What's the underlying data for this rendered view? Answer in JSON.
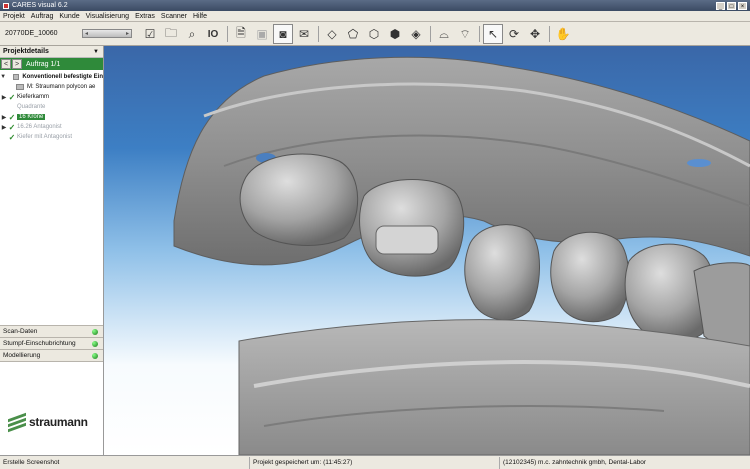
{
  "window": {
    "title": "CARES visual 6.2"
  },
  "menu": [
    "Projekt",
    "Auftrag",
    "Kunde",
    "Visualisierung",
    "Extras",
    "Scanner",
    "Hilfe"
  ],
  "toolbar": {
    "job_number": "20770DE_10060",
    "icons": [
      "checklist-icon",
      "open-folder-icon",
      "search-icon",
      "io-icon",
      "document-icon",
      "save-icon",
      "camera-icon",
      "mail-icon",
      "view-top-icon",
      "view-front-icon",
      "view-side-icon",
      "view-back-icon",
      "view-bottom-icon",
      "tooth-upper-icon",
      "tooth-lower-icon",
      "pointer-icon",
      "rotate-icon",
      "move-icon",
      "hand-icon"
    ],
    "io_label": "IO"
  },
  "sidebar": {
    "header": "Projektdetails",
    "auftrag_label": "Auftrag 1/1",
    "tree": [
      {
        "text": "Konventionell befestigte Ein",
        "style": "bold",
        "expander": "▼"
      },
      {
        "text": "M: Straumann polycon ae",
        "style": "normal"
      },
      {
        "text": "Kieferkamm",
        "style": "normal",
        "check": true,
        "expander": "▶"
      },
      {
        "text": "Quadrante",
        "style": "dim"
      },
      {
        "text": "16 Krone",
        "style": "sel",
        "check": true,
        "expander": "▶"
      },
      {
        "text": "16.26 Antagonist",
        "style": "dim",
        "check": true,
        "expander": "▶"
      },
      {
        "text": "Kiefer mit Antagonist",
        "style": "dim",
        "check": true
      }
    ],
    "panels": [
      "Scan-Daten",
      "Stumpf-Einschubrichtung",
      "Modellierung"
    ],
    "logo_text": "straumann"
  },
  "status": {
    "left": "Erstelle Screenshot",
    "middle": "Projekt gespeichert um: (11:45:27)",
    "right": "(12102345) m.c. zahntechnik gmbh, Dental-Labor"
  },
  "colors": {
    "accent_green": "#2f8a3a",
    "viewport_top": "#3a67a8",
    "viewport_bottom": "#ffffff"
  }
}
